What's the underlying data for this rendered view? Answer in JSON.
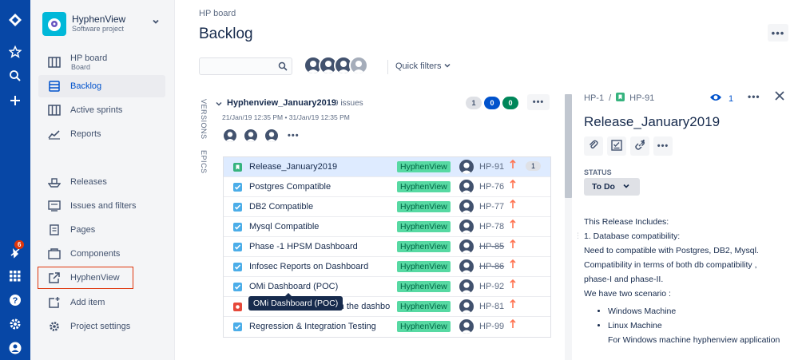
{
  "colors": {
    "global_nav": "#0747a6",
    "accent": "#0052cc",
    "epic_green": "#57d9a3",
    "story_green": "#36b37e",
    "task_blue": "#4bade8",
    "bug_red": "#e5493a",
    "priority_orange": "#ff7452"
  },
  "global_nav": {
    "icons": [
      "jira-logo-icon",
      "star-icon",
      "search-icon",
      "plus-icon",
      "notifications-icon",
      "apps-grid-icon",
      "help-icon",
      "settings-icon",
      "user-profile-icon"
    ],
    "notification_count": "6"
  },
  "sidebar": {
    "project_name": "HyphenView",
    "project_type": "Software project",
    "board": {
      "label": "HP board",
      "sub": "Board"
    },
    "items": [
      {
        "label": "Backlog",
        "icon": "backlog-icon"
      },
      {
        "label": "Active sprints",
        "icon": "columns-icon"
      },
      {
        "label": "Reports",
        "icon": "reports-icon"
      },
      {
        "label": "Releases",
        "icon": "ship-icon"
      },
      {
        "label": "Issues and filters",
        "icon": "issues-icon"
      },
      {
        "label": "Pages",
        "icon": "page-icon"
      },
      {
        "label": "Components",
        "icon": "component-icon"
      },
      {
        "label": "HyphenView",
        "icon": "external-link-icon"
      },
      {
        "label": "Add item",
        "icon": "add-item-icon"
      },
      {
        "label": "Project settings",
        "icon": "gear-icon"
      }
    ]
  },
  "header": {
    "breadcrumb": "HP board",
    "title": "Backlog",
    "quick_filters": "Quick filters"
  },
  "side_tabs": {
    "versions": "VERSIONS",
    "epics": "EPICS"
  },
  "sprint": {
    "name": "Hyphenview_January2019",
    "issue_count": "9 issues",
    "dates": "21/Jan/19 12:35 PM • 31/Jan/19 12:35 PM",
    "counts": {
      "todo": "1",
      "in_progress": "0",
      "done": "0"
    },
    "issues": [
      {
        "type": "story",
        "summary": "Release_January2019",
        "epic": "HyphenView",
        "key": "HP-91",
        "done": false,
        "estimate": "1"
      },
      {
        "type": "task",
        "summary": "Postgres Compatible",
        "epic": "HyphenView",
        "key": "HP-76",
        "done": false
      },
      {
        "type": "task",
        "summary": "DB2 Compatible",
        "epic": "HyphenView",
        "key": "HP-77",
        "done": false
      },
      {
        "type": "task",
        "summary": "Mysql Compatible",
        "epic": "HyphenView",
        "key": "HP-78",
        "done": false
      },
      {
        "type": "task",
        "summary": "Phase -1 HPSM Dashboard",
        "epic": "HyphenView",
        "key": "HP-85",
        "done": true
      },
      {
        "type": "task",
        "summary": "Infosec Reports on Dashboard",
        "epic": "HyphenView",
        "key": "HP-86",
        "done": true
      },
      {
        "type": "task",
        "summary": "OMi Dashboard (POC)",
        "epic": "HyphenView",
        "key": "HP-92",
        "done": false
      },
      {
        "type": "bug",
        "summary": "ut in the dashbo",
        "epic": "HyphenView",
        "key": "HP-81",
        "done": false
      },
      {
        "type": "task",
        "summary": "Regression & Integration Testing",
        "epic": "HyphenView",
        "key": "HP-99",
        "done": false
      }
    ],
    "tooltip": "OMi Dashboard (POC)"
  },
  "detail": {
    "parent_key": "HP-1",
    "key": "HP-91",
    "watchers": "1",
    "title": "Release_January2019",
    "status_label": "STATUS",
    "status": "To Do",
    "description": {
      "lines": [
        "This Release Includes:",
        "1. Database compatibility:",
        "Need to compatible with Postgres, DB2, Mysql.",
        "Compatibility in terms of both db compatibility ,",
        "phase-I and phase-II.",
        "We have two scenario :"
      ],
      "bullets": [
        "Windows Machine",
        "Linux Machine"
      ],
      "trailing": "For Windows machine hyphenview application"
    }
  }
}
